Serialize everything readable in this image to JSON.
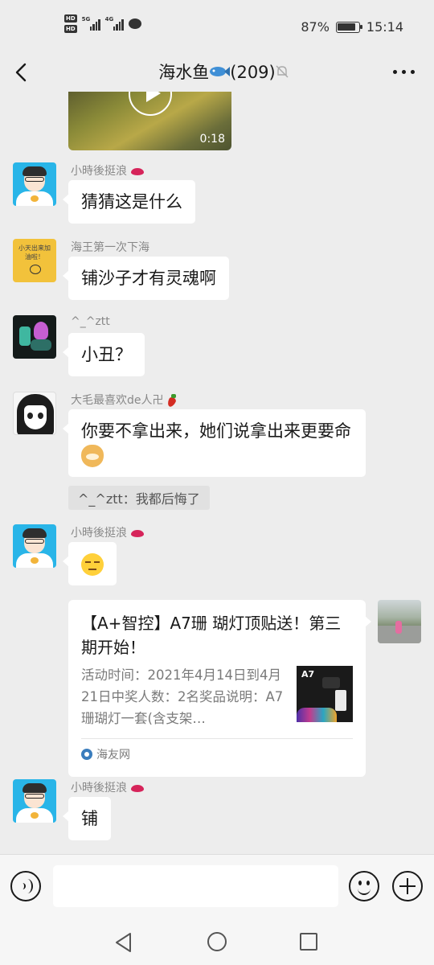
{
  "status": {
    "hd1": "HD",
    "hd2": "HD",
    "net1": "5G",
    "net2": "4G",
    "battery": "87%",
    "battery_level": 0.87,
    "time": "15:14"
  },
  "header": {
    "title": "海水鱼",
    "count": "(209)",
    "icons": [
      "back-arrow",
      "fish-emoji",
      "mute-bell",
      "more-dots"
    ]
  },
  "video": {
    "duration": "0:18"
  },
  "messages": [
    {
      "nick": "小時後挺浪",
      "text": "猜猜这是什么"
    },
    {
      "nick": "海王第一次下海",
      "text": "铺沙子才有灵魂啊"
    },
    {
      "nick": "^_^ztt",
      "text": "小丑？"
    },
    {
      "nick": "大毛最喜欢de人卍",
      "text": "你要不拿出来，她们说拿出来更要命",
      "quote": "^_^ztt：我都后悔了"
    },
    {
      "nick": "小時後挺浪"
    },
    {
      "nick": "小時後挺浪",
      "text": "铺"
    }
  ],
  "avatar_text": "小天出来加油啦！",
  "card": {
    "title": "【A+智控】A7珊 瑚灯顶贴送！第三期开始！",
    "desc": "活动时间：2021年4月14日到4月21日中奖人数：2名奖品说明：A7珊瑚灯一套(含支架…",
    "thumb_text": "A7",
    "source": "海友网"
  },
  "colors": {
    "background": "#ededed",
    "bubble": "#ffffff",
    "muted_text": "#888888"
  }
}
